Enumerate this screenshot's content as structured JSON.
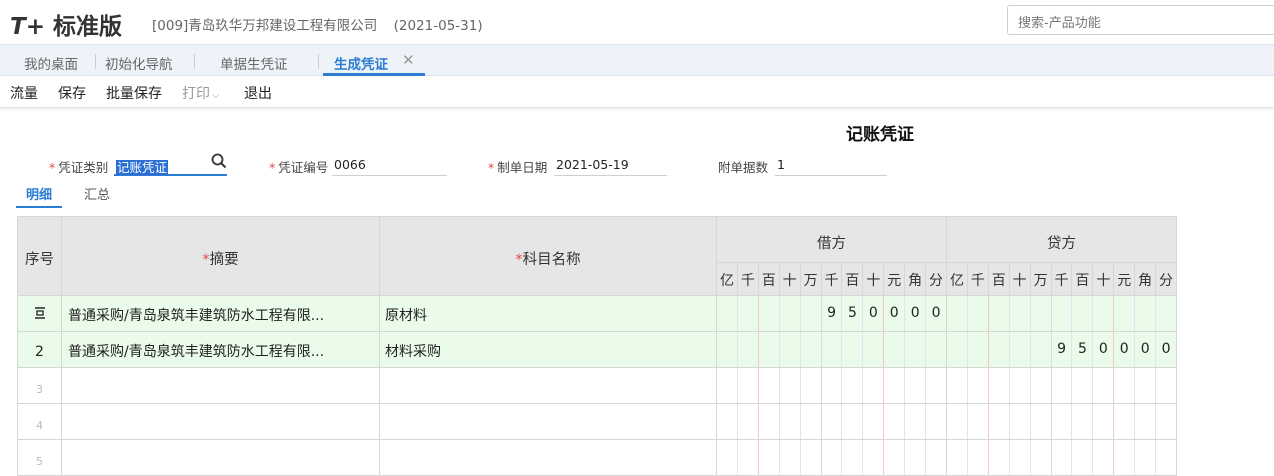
{
  "header": {
    "logo_t": "T+",
    "logo_text": "标准版",
    "company": "[009]青岛玖华万邦建设工程有限公司",
    "date": "(2021-05-31)",
    "search_placeholder": "搜索-产品功能"
  },
  "tabs": [
    {
      "label": "我的桌面"
    },
    {
      "label": "初始化导航"
    },
    {
      "label": "单据生凭证"
    },
    {
      "label": "生成凭证",
      "active": true
    }
  ],
  "toolbar": [
    "流量",
    "保存",
    "批量保存",
    "打印",
    "退出"
  ],
  "voucher": {
    "title": "记账凭证",
    "type_label": "凭证类别",
    "type_value": "记账凭证",
    "number_label": "凭证编号",
    "number_value": "0066",
    "date_label": "制单日期",
    "date_value": "2021-05-19",
    "attach_label": "附单据数",
    "attach_value": "1"
  },
  "subtabs": [
    "明细",
    "汇总"
  ],
  "grid": {
    "headers": {
      "seq": "序号",
      "summary": "摘要",
      "account": "科目名称",
      "debit": "借方",
      "credit": "贷方",
      "units": [
        "亿",
        "千",
        "百",
        "十",
        "万",
        "千",
        "百",
        "十",
        "元",
        "角",
        "分"
      ]
    },
    "rows": [
      {
        "seq": "",
        "summary": "普通采购/青岛泉筑丰建筑防水工程有限...",
        "account": "原材料",
        "debit": "950000",
        "credit": ""
      },
      {
        "seq": "2",
        "summary": "普通采购/青岛泉筑丰建筑防水工程有限...",
        "account": "材料采购",
        "debit": "",
        "credit": "950000"
      },
      {
        "seq": "3",
        "summary": "",
        "account": "",
        "debit": "",
        "credit": ""
      },
      {
        "seq": "4",
        "summary": "",
        "account": "",
        "debit": "",
        "credit": ""
      },
      {
        "seq": "5",
        "summary": "",
        "account": "",
        "debit": "",
        "credit": ""
      }
    ]
  },
  "colors": {
    "accent": "#2b7cd3",
    "required": "#e54545",
    "row_highlight": "#eafbea",
    "header_bg": "#e6e6e6"
  }
}
